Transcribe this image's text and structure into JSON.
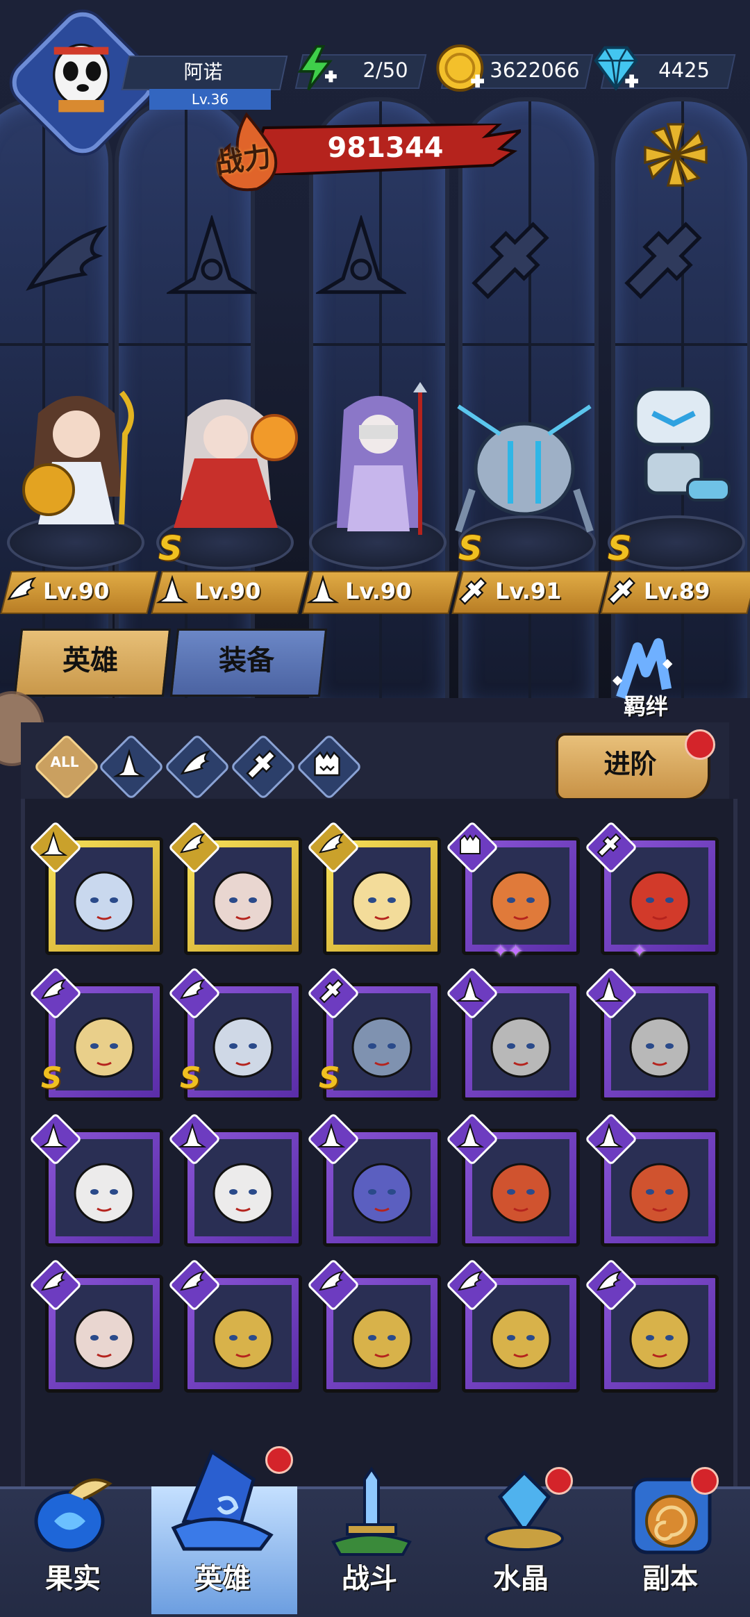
{
  "player": {
    "name": "阿诺",
    "level": "Lv.36"
  },
  "resources": {
    "energy": "2/50",
    "gold": "3622066",
    "gems": "4425"
  },
  "power": {
    "label": "战力",
    "value": "981344"
  },
  "lineup": [
    {
      "level": "Lv.90",
      "class_icon": "wing-icon",
      "s_rank": false
    },
    {
      "level": "Lv.90",
      "class_icon": "hat-icon",
      "s_rank": true,
      "s_label": "S"
    },
    {
      "level": "Lv.90",
      "class_icon": "hat-icon",
      "s_rank": false
    },
    {
      "level": "Lv.91",
      "class_icon": "wrench-icon",
      "s_rank": true,
      "s_label": "S"
    },
    {
      "level": "Lv.89",
      "class_icon": "wrench-icon",
      "s_rank": true,
      "s_label": "S"
    }
  ],
  "tabs": {
    "heroes": "英雄",
    "equipment": "装备"
  },
  "bond": {
    "label": "羁绊"
  },
  "filters": {
    "all": "ALL"
  },
  "advance": {
    "label": "进阶"
  },
  "colors": {
    "gold_card": "#f7e25a",
    "purple_card": "#8a55d6",
    "accent_red": "#d4242a",
    "level_plate": "#e0ab45"
  },
  "roster": [
    {
      "frame": "gold",
      "class_icon": "hat-icon"
    },
    {
      "frame": "gold",
      "class_icon": "wing-icon"
    },
    {
      "frame": "gold",
      "class_icon": "wing-icon"
    },
    {
      "frame": "purple",
      "class_icon": "monster-icon",
      "stars": "✦✦"
    },
    {
      "frame": "purple",
      "class_icon": "wrench-icon",
      "stars": "✦"
    },
    {
      "frame": "purple",
      "class_icon": "wing-icon",
      "s_label": "S"
    },
    {
      "frame": "purple",
      "class_icon": "wing-icon",
      "s_label": "S"
    },
    {
      "frame": "purple",
      "class_icon": "wrench-icon",
      "s_label": "S"
    },
    {
      "frame": "purple",
      "class_icon": "hat-icon"
    },
    {
      "frame": "purple",
      "class_icon": "hat-icon"
    },
    {
      "frame": "purple",
      "class_icon": "hat-icon"
    },
    {
      "frame": "purple",
      "class_icon": "hat-icon"
    },
    {
      "frame": "purple",
      "class_icon": "hat-icon"
    },
    {
      "frame": "purple",
      "class_icon": "hat-icon"
    },
    {
      "frame": "purple",
      "class_icon": "hat-icon"
    },
    {
      "frame": "purple",
      "class_icon": "wing-icon"
    },
    {
      "frame": "purple",
      "class_icon": "wing-icon"
    },
    {
      "frame": "purple",
      "class_icon": "wing-icon"
    },
    {
      "frame": "purple",
      "class_icon": "wing-icon"
    },
    {
      "frame": "purple",
      "class_icon": "wing-icon"
    }
  ],
  "nav": {
    "fruit": "果实",
    "heroes": "英雄",
    "battle": "战斗",
    "crystal": "水晶",
    "dungeon": "副本"
  }
}
